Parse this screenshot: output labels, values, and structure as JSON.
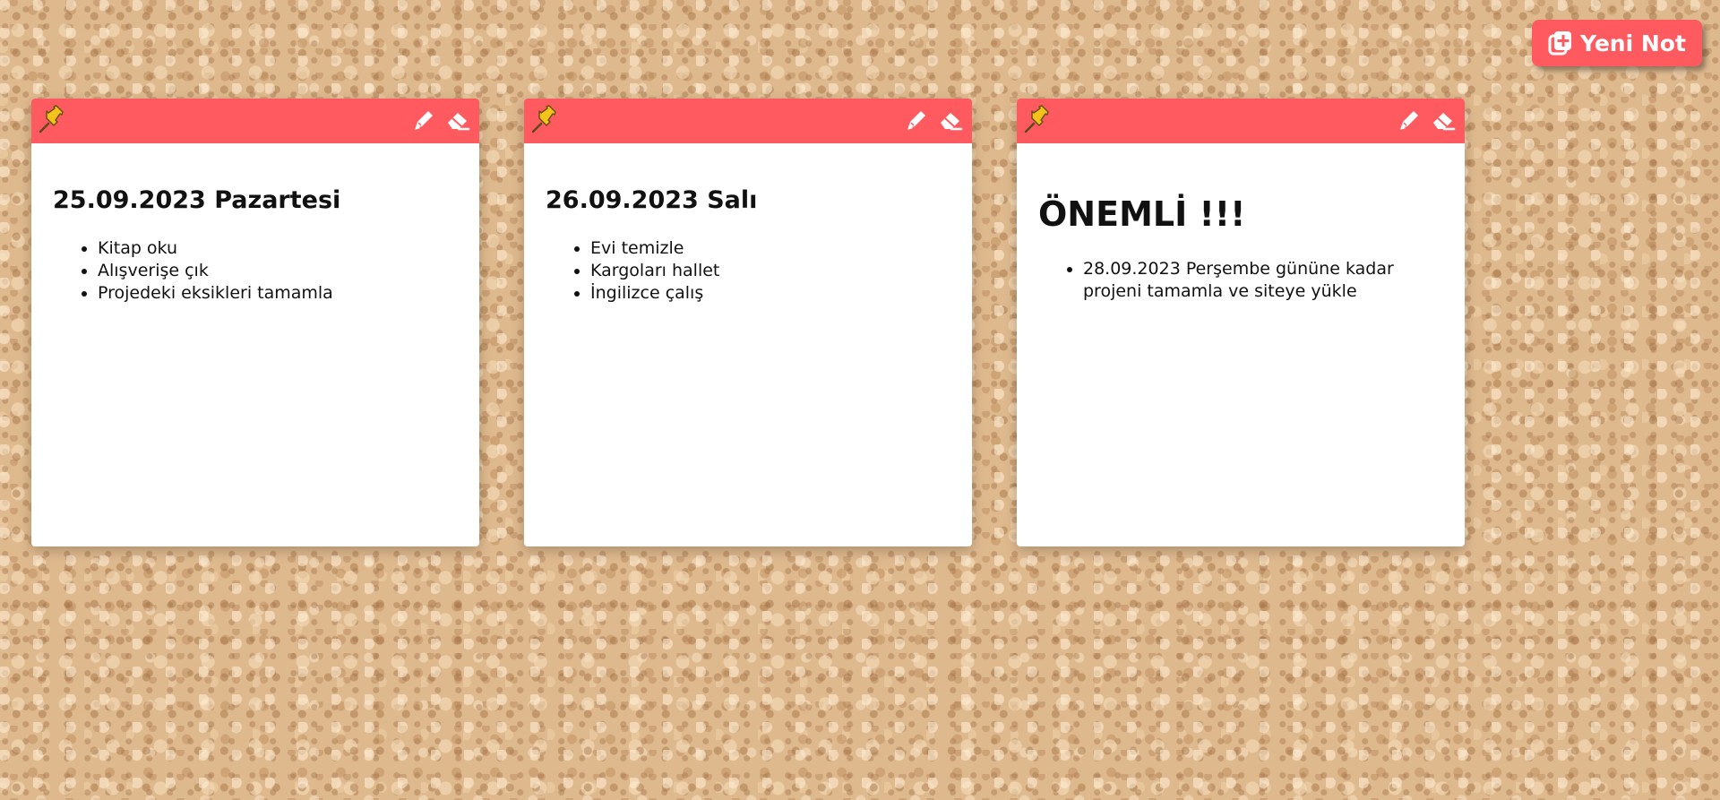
{
  "toolbar": {
    "new_note_label": "Yeni Not",
    "new_note_icon": "add-note-icon"
  },
  "colors": {
    "accent": "#ff5a5f",
    "card": "#ffffff",
    "pin": "#f3c21b"
  },
  "notes": [
    {
      "title": "25.09.2023 Pazartesi",
      "items": [
        "Kitap oku",
        "Alışverişe çık",
        "Projedeki eksikleri tamamla"
      ],
      "icons": [
        "pin-icon",
        "pencil-icon",
        "eraser-icon"
      ]
    },
    {
      "title": "26.09.2023 Salı",
      "items": [
        "Evi temizle",
        "Kargoları hallet",
        "İngilizce çalış"
      ],
      "icons": [
        "pin-icon",
        "pencil-icon",
        "eraser-icon"
      ]
    },
    {
      "title": "ÖNEMLİ !!!",
      "items": [
        "28.09.2023 Perşembe gününe kadar projeni tamamla ve siteye yükle"
      ],
      "icons": [
        "pin-icon",
        "pencil-icon",
        "eraser-icon"
      ]
    }
  ]
}
